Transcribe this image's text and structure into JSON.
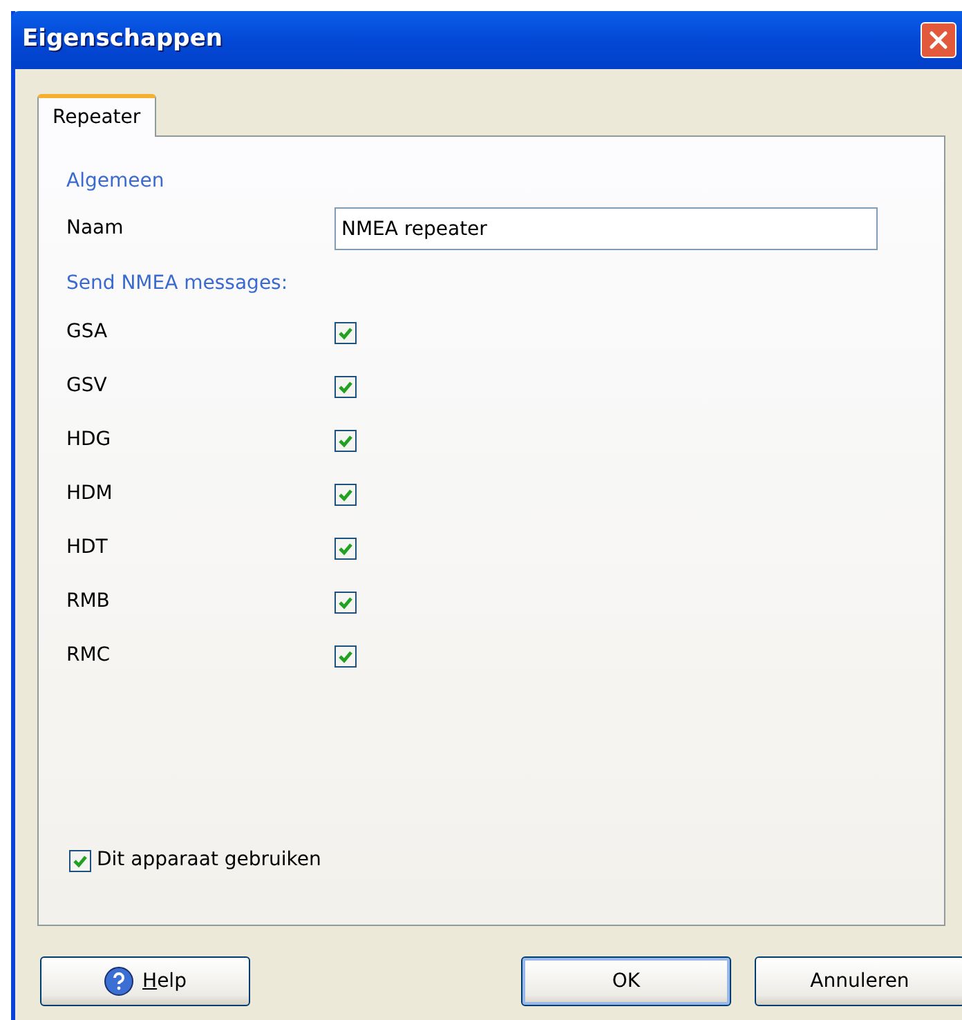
{
  "window": {
    "title": "Eigenschappen"
  },
  "tabs": [
    {
      "label": "Repeater",
      "selected": true
    }
  ],
  "general": {
    "heading": "Algemeen",
    "name_label": "Naam",
    "name_value": "NMEA repeater"
  },
  "messages": {
    "heading": "Send NMEA messages:",
    "items": [
      {
        "label": "GSA",
        "checked": true
      },
      {
        "label": "GSV",
        "checked": true
      },
      {
        "label": "HDG",
        "checked": true
      },
      {
        "label": "HDM",
        "checked": true
      },
      {
        "label": "HDT",
        "checked": true
      },
      {
        "label": "RMB",
        "checked": true
      },
      {
        "label": "RMC",
        "checked": true
      }
    ]
  },
  "use_device": {
    "label": "Dit apparaat gebruiken",
    "checked": true
  },
  "buttons": [
    {
      "kind": "help",
      "label": "Help"
    },
    {
      "kind": "ok",
      "label": "OK"
    },
    {
      "kind": "cancel",
      "label": "Annuleren"
    }
  ]
}
